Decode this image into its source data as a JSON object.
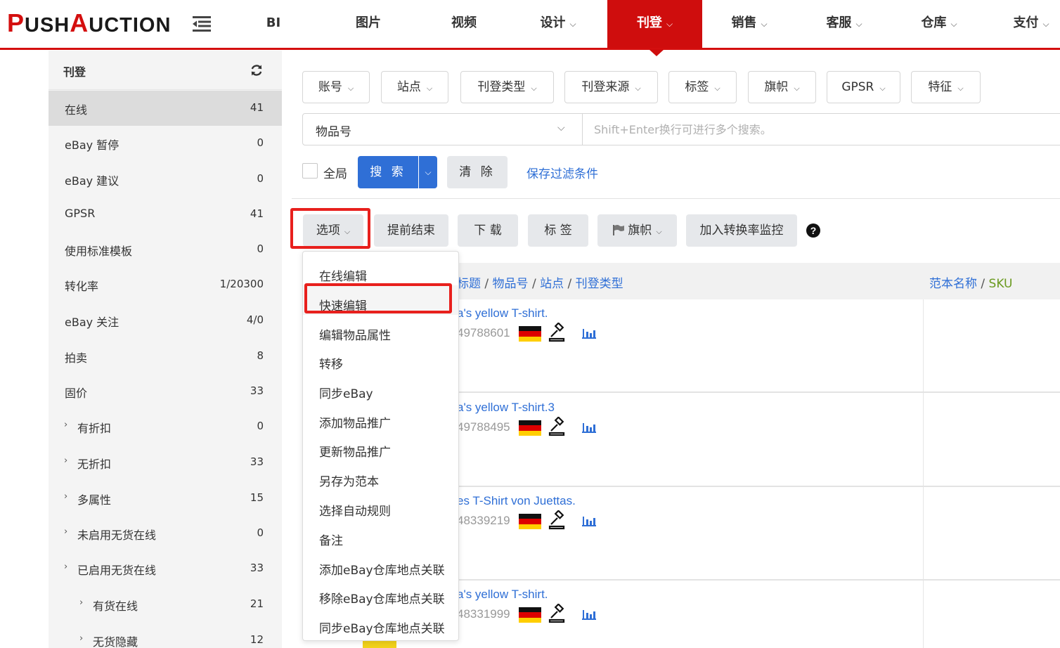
{
  "brand": {
    "logo_letters": [
      "P",
      "USH",
      "A",
      "UCTION"
    ],
    "accent": "#d40f0f"
  },
  "nav": {
    "items": [
      {
        "label": "BI",
        "dropdown": false
      },
      {
        "label": "图片",
        "dropdown": false
      },
      {
        "label": "视频",
        "dropdown": false
      },
      {
        "label": "设计",
        "dropdown": true
      },
      {
        "label": "刊登",
        "dropdown": true,
        "active": true
      },
      {
        "label": "销售",
        "dropdown": true
      },
      {
        "label": "客服",
        "dropdown": true
      },
      {
        "label": "仓库",
        "dropdown": true
      },
      {
        "label": "支付",
        "dropdown": true
      }
    ]
  },
  "sidebar": {
    "title": "刊登",
    "items": [
      {
        "label": "在线",
        "count": "41",
        "active": true
      },
      {
        "label": "eBay 暂停",
        "count": "0"
      },
      {
        "label": "eBay 建议",
        "count": "0"
      },
      {
        "label": "GPSR",
        "count": "41"
      },
      {
        "label": "使用标准模板",
        "count": "0"
      },
      {
        "label": "转化率",
        "count": "1/20300"
      },
      {
        "label": "eBay 关注",
        "count": "4/0"
      },
      {
        "label": "拍卖",
        "count": "8"
      },
      {
        "label": "固价",
        "count": "33"
      },
      {
        "label": "有折扣",
        "count": "0",
        "expandable": true,
        "level": 1
      },
      {
        "label": "无折扣",
        "count": "33",
        "expandable": true,
        "level": 1
      },
      {
        "label": "多属性",
        "count": "15",
        "expandable": true,
        "level": 1
      },
      {
        "label": "未启用无货在线",
        "count": "0",
        "expandable": true,
        "level": 1
      },
      {
        "label": "已启用无货在线",
        "count": "33",
        "expandable": true,
        "level": 1
      },
      {
        "label": "有货在线",
        "count": "21",
        "expandable": true,
        "level": 2
      },
      {
        "label": "无货隐藏",
        "count": "12",
        "expandable": true,
        "level": 2
      }
    ]
  },
  "filters": {
    "buttons": [
      "账号",
      "站点",
      "刊登类型",
      "刊登来源",
      "标签",
      "旗帜",
      "GPSR",
      "特征"
    ],
    "search_field": "物品号",
    "search_placeholder": "Shift+Enter换行可进行多个搜索。",
    "global_label": "全局",
    "search_btn": "搜 索",
    "clear_btn": "清 除",
    "save_link": "保存过滤条件"
  },
  "actions": {
    "options": "选项",
    "end_early": "提前结束",
    "download": "下 载",
    "tag": "标 签",
    "flag": "旗帜",
    "add_monitor": "加入转换率监控"
  },
  "table": {
    "header_left": [
      "标题",
      "物品号",
      "站点",
      "刊登类型"
    ],
    "header_right": [
      "范本名称",
      "SKU"
    ],
    "rows": [
      {
        "title": "a's yellow T-shirt.",
        "item_no": "49788601"
      },
      {
        "title": "a's yellow T-shirt.3",
        "item_no": "49788495"
      },
      {
        "title": "es T-Shirt von Juettas.",
        "item_no": "48339219"
      },
      {
        "title": "a's yellow T-shirt.",
        "item_no": "48331999"
      }
    ],
    "link_color": "#2f6fd6"
  },
  "dropdown_menu": {
    "items": [
      "在线编辑",
      "快速编辑",
      "编辑物品属性",
      "转移",
      "同步eBay",
      "添加物品推广",
      "更新物品推广",
      "另存为范本",
      "选择自动规则",
      "备注",
      "添加eBay仓库地点关联",
      "移除eBay仓库地点关联",
      "同步eBay仓库地点关联"
    ],
    "highlighted": "快速编辑"
  }
}
